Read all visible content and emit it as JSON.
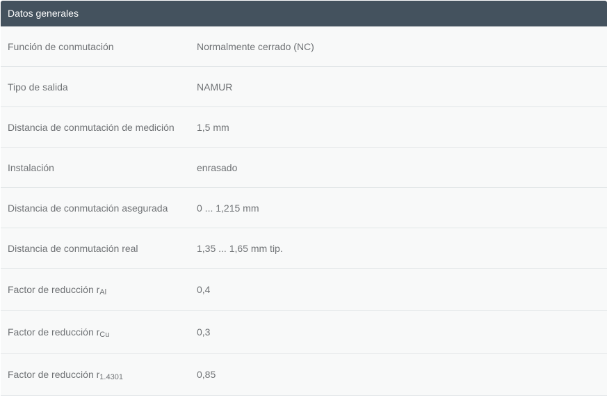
{
  "section": {
    "title": "Datos generales"
  },
  "rows": [
    {
      "label": "Función de conmutación",
      "value": "Normalmente cerrado (NC)"
    },
    {
      "label": "Tipo de salida",
      "value": "NAMUR"
    },
    {
      "label": "Distancia de conmutación de medición",
      "value": "1,5 mm"
    },
    {
      "label": "Instalación",
      "value": "enrasado"
    },
    {
      "label": "Distancia de conmutación asegurada",
      "value": "0 ... 1,215 mm"
    },
    {
      "label": "Distancia de conmutación real",
      "value": "1,35 ... 1,65 mm tip."
    },
    {
      "label": "Factor de reducción r",
      "label_sub": "Al",
      "value": "0,4"
    },
    {
      "label": "Factor de reducción r",
      "label_sub": "Cu",
      "value": "0,3"
    },
    {
      "label": "Factor de reducción r",
      "label_sub": "1.4301",
      "value": "0,85"
    }
  ]
}
